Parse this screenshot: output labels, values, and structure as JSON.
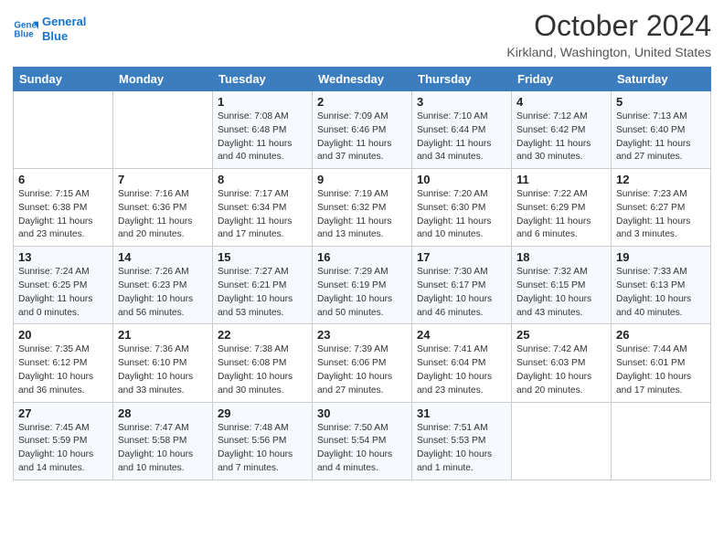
{
  "header": {
    "logo_line1": "General",
    "logo_line2": "Blue",
    "title": "October 2024",
    "location": "Kirkland, Washington, United States"
  },
  "weekdays": [
    "Sunday",
    "Monday",
    "Tuesday",
    "Wednesday",
    "Thursday",
    "Friday",
    "Saturday"
  ],
  "weeks": [
    [
      {
        "day": "",
        "info": ""
      },
      {
        "day": "",
        "info": ""
      },
      {
        "day": "1",
        "info": "Sunrise: 7:08 AM\nSunset: 6:48 PM\nDaylight: 11 hours and 40 minutes."
      },
      {
        "day": "2",
        "info": "Sunrise: 7:09 AM\nSunset: 6:46 PM\nDaylight: 11 hours and 37 minutes."
      },
      {
        "day": "3",
        "info": "Sunrise: 7:10 AM\nSunset: 6:44 PM\nDaylight: 11 hours and 34 minutes."
      },
      {
        "day": "4",
        "info": "Sunrise: 7:12 AM\nSunset: 6:42 PM\nDaylight: 11 hours and 30 minutes."
      },
      {
        "day": "5",
        "info": "Sunrise: 7:13 AM\nSunset: 6:40 PM\nDaylight: 11 hours and 27 minutes."
      }
    ],
    [
      {
        "day": "6",
        "info": "Sunrise: 7:15 AM\nSunset: 6:38 PM\nDaylight: 11 hours and 23 minutes."
      },
      {
        "day": "7",
        "info": "Sunrise: 7:16 AM\nSunset: 6:36 PM\nDaylight: 11 hours and 20 minutes."
      },
      {
        "day": "8",
        "info": "Sunrise: 7:17 AM\nSunset: 6:34 PM\nDaylight: 11 hours and 17 minutes."
      },
      {
        "day": "9",
        "info": "Sunrise: 7:19 AM\nSunset: 6:32 PM\nDaylight: 11 hours and 13 minutes."
      },
      {
        "day": "10",
        "info": "Sunrise: 7:20 AM\nSunset: 6:30 PM\nDaylight: 11 hours and 10 minutes."
      },
      {
        "day": "11",
        "info": "Sunrise: 7:22 AM\nSunset: 6:29 PM\nDaylight: 11 hours and 6 minutes."
      },
      {
        "day": "12",
        "info": "Sunrise: 7:23 AM\nSunset: 6:27 PM\nDaylight: 11 hours and 3 minutes."
      }
    ],
    [
      {
        "day": "13",
        "info": "Sunrise: 7:24 AM\nSunset: 6:25 PM\nDaylight: 11 hours and 0 minutes."
      },
      {
        "day": "14",
        "info": "Sunrise: 7:26 AM\nSunset: 6:23 PM\nDaylight: 10 hours and 56 minutes."
      },
      {
        "day": "15",
        "info": "Sunrise: 7:27 AM\nSunset: 6:21 PM\nDaylight: 10 hours and 53 minutes."
      },
      {
        "day": "16",
        "info": "Sunrise: 7:29 AM\nSunset: 6:19 PM\nDaylight: 10 hours and 50 minutes."
      },
      {
        "day": "17",
        "info": "Sunrise: 7:30 AM\nSunset: 6:17 PM\nDaylight: 10 hours and 46 minutes."
      },
      {
        "day": "18",
        "info": "Sunrise: 7:32 AM\nSunset: 6:15 PM\nDaylight: 10 hours and 43 minutes."
      },
      {
        "day": "19",
        "info": "Sunrise: 7:33 AM\nSunset: 6:13 PM\nDaylight: 10 hours and 40 minutes."
      }
    ],
    [
      {
        "day": "20",
        "info": "Sunrise: 7:35 AM\nSunset: 6:12 PM\nDaylight: 10 hours and 36 minutes."
      },
      {
        "day": "21",
        "info": "Sunrise: 7:36 AM\nSunset: 6:10 PM\nDaylight: 10 hours and 33 minutes."
      },
      {
        "day": "22",
        "info": "Sunrise: 7:38 AM\nSunset: 6:08 PM\nDaylight: 10 hours and 30 minutes."
      },
      {
        "day": "23",
        "info": "Sunrise: 7:39 AM\nSunset: 6:06 PM\nDaylight: 10 hours and 27 minutes."
      },
      {
        "day": "24",
        "info": "Sunrise: 7:41 AM\nSunset: 6:04 PM\nDaylight: 10 hours and 23 minutes."
      },
      {
        "day": "25",
        "info": "Sunrise: 7:42 AM\nSunset: 6:03 PM\nDaylight: 10 hours and 20 minutes."
      },
      {
        "day": "26",
        "info": "Sunrise: 7:44 AM\nSunset: 6:01 PM\nDaylight: 10 hours and 17 minutes."
      }
    ],
    [
      {
        "day": "27",
        "info": "Sunrise: 7:45 AM\nSunset: 5:59 PM\nDaylight: 10 hours and 14 minutes."
      },
      {
        "day": "28",
        "info": "Sunrise: 7:47 AM\nSunset: 5:58 PM\nDaylight: 10 hours and 10 minutes."
      },
      {
        "day": "29",
        "info": "Sunrise: 7:48 AM\nSunset: 5:56 PM\nDaylight: 10 hours and 7 minutes."
      },
      {
        "day": "30",
        "info": "Sunrise: 7:50 AM\nSunset: 5:54 PM\nDaylight: 10 hours and 4 minutes."
      },
      {
        "day": "31",
        "info": "Sunrise: 7:51 AM\nSunset: 5:53 PM\nDaylight: 10 hours and 1 minute."
      },
      {
        "day": "",
        "info": ""
      },
      {
        "day": "",
        "info": ""
      }
    ]
  ]
}
